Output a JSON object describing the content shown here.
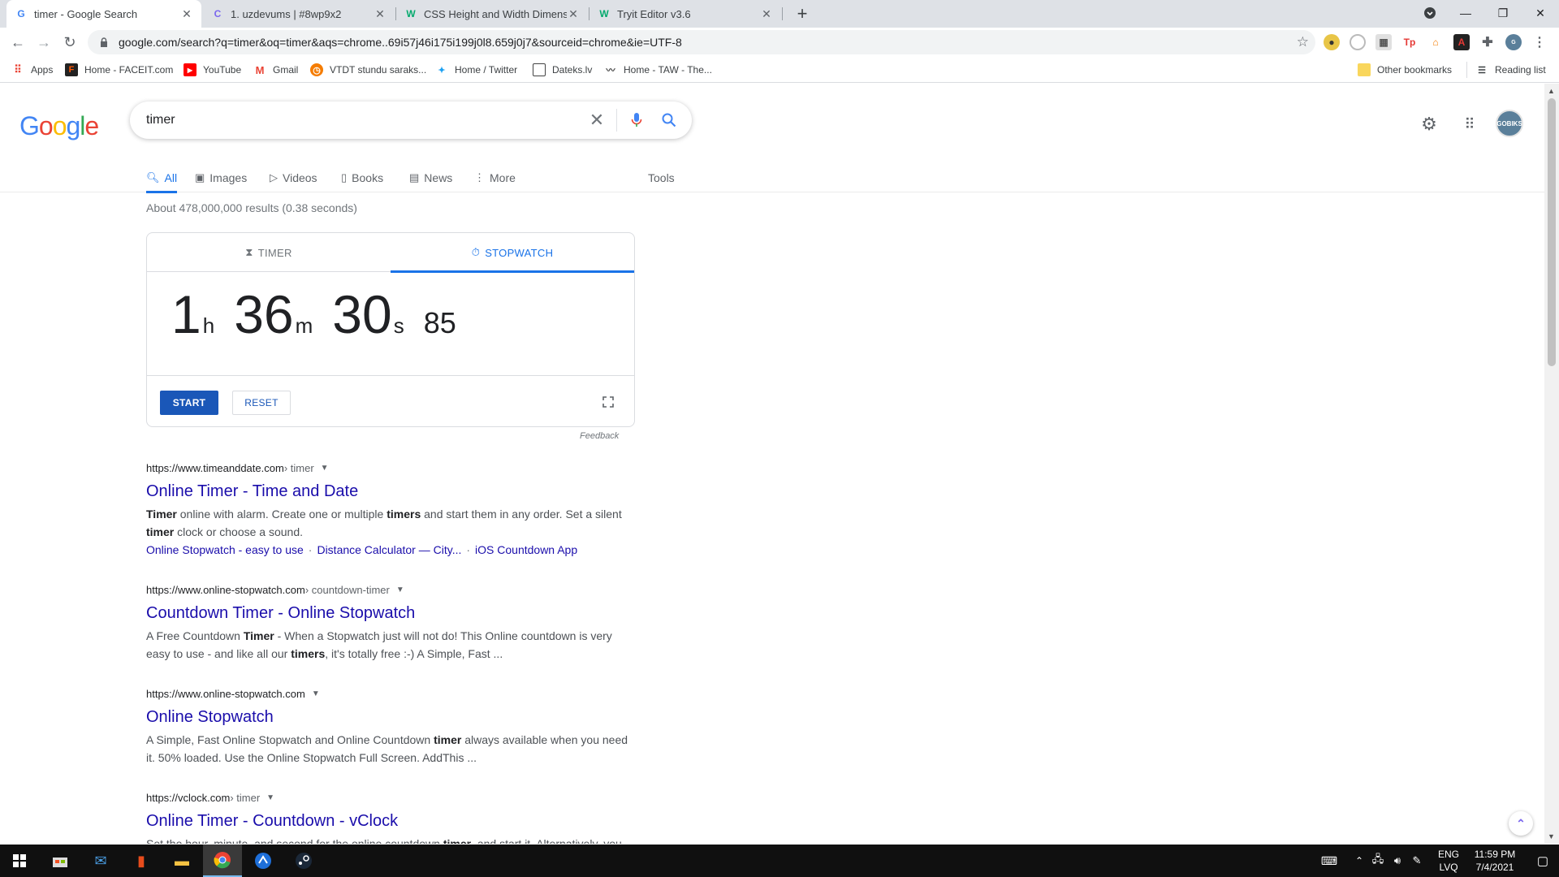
{
  "browser": {
    "tabs": [
      {
        "title": "timer - Google Search",
        "favicon": "G"
      },
      {
        "title": "1. uzdevums | #8wp9x2",
        "favicon": "C"
      },
      {
        "title": "CSS Height and Width Dimension",
        "favicon": "W"
      },
      {
        "title": "Tryit Editor v3.6",
        "favicon": "W"
      }
    ],
    "url": "google.com/search?q=timer&oq=timer&aqs=chrome..69i57j46i175i199j0l8.659j0j7&sourceid=chrome&ie=UTF-8",
    "bookmarks": [
      {
        "label": "Apps"
      },
      {
        "label": "Home - FACEIT.com"
      },
      {
        "label": "YouTube"
      },
      {
        "label": "Gmail"
      },
      {
        "label": "VTDT stundu saraks..."
      },
      {
        "label": "Home / Twitter"
      },
      {
        "label": "Dateks.lv"
      },
      {
        "label": "Home - TAW - The..."
      }
    ],
    "other_bookmarks": "Other bookmarks",
    "reading_list": "Reading list"
  },
  "google": {
    "logo": "Google",
    "logo_colors": [
      "#4285f4",
      "#ea4335",
      "#fbbc05",
      "#4285f4",
      "#34a853",
      "#ea4335"
    ],
    "query": "timer",
    "avatar_text": "GOBIKS",
    "nav_tabs": [
      {
        "label": "All",
        "icon": "search-icon"
      },
      {
        "label": "Images",
        "icon": "image-icon"
      },
      {
        "label": "Videos",
        "icon": "video-icon"
      },
      {
        "label": "Books",
        "icon": "book-icon"
      },
      {
        "label": "News",
        "icon": "news-icon"
      },
      {
        "label": "More",
        "icon": "more-icon"
      }
    ],
    "tools": "Tools",
    "stats": "About 478,000,000 results (0.38 seconds)"
  },
  "widget": {
    "tab_timer": "TIMER",
    "tab_stopwatch": "STOPWATCH",
    "active_tab": "STOPWATCH",
    "hours": "1",
    "hours_unit": "h",
    "minutes": "36",
    "minutes_unit": "m",
    "seconds": "30",
    "seconds_unit": "s",
    "hundredths": "85",
    "start": "START",
    "reset": "RESET",
    "feedback": "Feedback"
  },
  "results": [
    {
      "domain": "https://www.timeanddate.com",
      "path": " › timer",
      "title": "Online Timer - Time and Date",
      "snippet_line1": [
        {
          "b": "Timer"
        },
        {
          "t": " online with alarm. Create one or multiple "
        },
        {
          "b": "timers"
        },
        {
          "t": " and start them in any order. Set a silent"
        }
      ],
      "snippet_line2": [
        {
          "b": "timer"
        },
        {
          "t": " clock or choose a sound."
        }
      ],
      "sitelinks": [
        "Online Stopwatch - easy to use",
        "Distance Calculator — City...",
        "iOS Countdown App"
      ]
    },
    {
      "domain": "https://www.online-stopwatch.com",
      "path": " › countdown-timer",
      "title": "Countdown Timer - Online Stopwatch",
      "snippet_line1": [
        {
          "t": "A Free Countdown "
        },
        {
          "b": "Timer"
        },
        {
          "t": " - When a Stopwatch just will not do! This Online countdown is very"
        }
      ],
      "snippet_line2": [
        {
          "t": "easy to use - and like all our "
        },
        {
          "b": "timers"
        },
        {
          "t": ", it's totally free :-) A Simple, Fast ..."
        }
      ]
    },
    {
      "domain": "https://www.online-stopwatch.com",
      "path": "",
      "title": "Online Stopwatch",
      "snippet_line1": [
        {
          "t": "A Simple, Fast Online Stopwatch and Online Countdown "
        },
        {
          "b": "timer"
        },
        {
          "t": " always available when you need"
        }
      ],
      "snippet_line2": [
        {
          "t": "it. 50% loaded. Use the Online Stopwatch Full Screen. AddThis ..."
        }
      ]
    },
    {
      "domain": "https://vclock.com",
      "path": " › timer",
      "title": "Online Timer - Countdown - vClock",
      "snippet_line1": [
        {
          "t": "Set the hour, minute, and second for the online countdown "
        },
        {
          "b": "timer"
        },
        {
          "t": ", and start it. Alternatively, you"
        }
      ]
    }
  ],
  "taskbar": {
    "lang": "ENG",
    "layout": "LVQ",
    "time": "11:59 PM",
    "date": "7/4/2021"
  }
}
